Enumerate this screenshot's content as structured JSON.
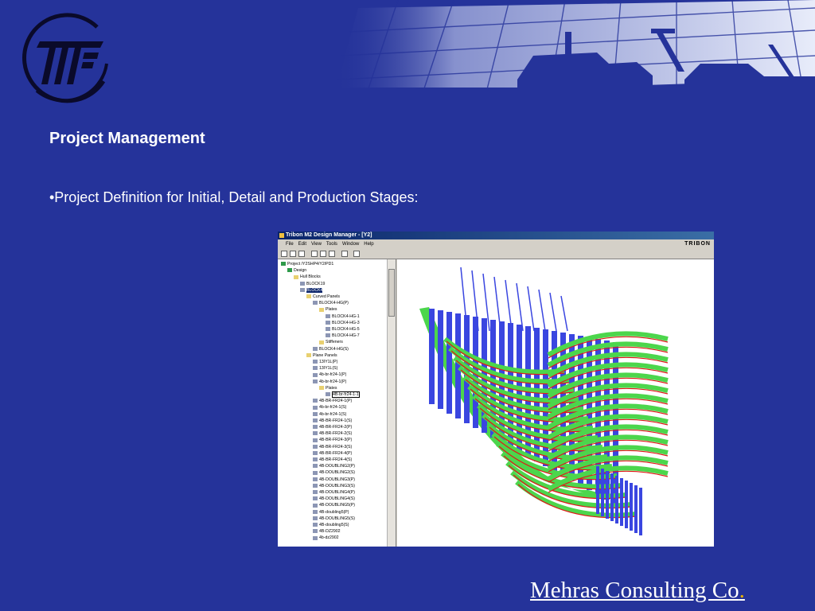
{
  "slide": {
    "heading": "Project Management",
    "bullet": "•Project Definition for Initial, Detail and Production Stages:",
    "footer": "Mehras Consulting Co",
    "footer_period": "."
  },
  "app": {
    "window_title": "Tribon M2 Design Manager - [Y2]",
    "brand": "TRIBON",
    "menu": [
      "File",
      "Edit",
      "View",
      "Tools",
      "Window",
      "Help"
    ],
    "tree": [
      {
        "label": "Project /Y2SHP4/Y2/PD1",
        "icon": "project-icon"
      },
      {
        "label": "Design",
        "icon": "design-icon"
      },
      {
        "label": "Hull Blocks",
        "icon": "folder-icon"
      },
      {
        "label": "BLOCK19",
        "icon": "block-icon"
      },
      {
        "label": "BLOCK4",
        "icon": "block-icon",
        "selected": true
      },
      {
        "label": "Curved Panels",
        "icon": "folder-icon"
      },
      {
        "label": "BLOCK4-HG(P)",
        "icon": "panel-icon"
      },
      {
        "label": "Plates",
        "icon": "folder-icon"
      },
      {
        "label": "BLOCK4-HG-1",
        "icon": "plate-icon"
      },
      {
        "label": "BLOCK4-HG-3",
        "icon": "plate-icon"
      },
      {
        "label": "BLOCK4-HG-5",
        "icon": "plate-icon"
      },
      {
        "label": "BLOCK4-HG-7",
        "icon": "plate-icon"
      },
      {
        "label": "Stiffeners",
        "icon": "folder-icon"
      },
      {
        "label": "BLOCK4-HG(S)",
        "icon": "panel-icon"
      },
      {
        "label": "Plane Panels",
        "icon": "folder-icon"
      },
      {
        "label": "13IY1L(P)",
        "icon": "panel-icon"
      },
      {
        "label": "13IY1L(S)",
        "icon": "panel-icon"
      },
      {
        "label": "4b-br-fr24-1(P)",
        "icon": "panel-icon"
      },
      {
        "label": "4b-br-fr24-1(P)",
        "icon": "panel-icon"
      },
      {
        "label": "Plates",
        "icon": "folder-icon"
      },
      {
        "label": "4B-br-fr24-1-1",
        "icon": "plate-icon",
        "editing": true
      },
      {
        "label": "4B-BR-FR24-1(P)",
        "icon": "panel-icon"
      },
      {
        "label": "4b-br-fr24-1(S)",
        "icon": "panel-icon"
      },
      {
        "label": "4b-br-fr24-1(S)",
        "icon": "panel-icon"
      },
      {
        "label": "4B-BR-FR24-1(S)",
        "icon": "panel-icon"
      },
      {
        "label": "4B-BR-FR24-2(P)",
        "icon": "panel-icon"
      },
      {
        "label": "4B-BR-FR24-2(S)",
        "icon": "panel-icon"
      },
      {
        "label": "4B-BR-FR24-3(P)",
        "icon": "panel-icon"
      },
      {
        "label": "4B-BR-FR24-3(S)",
        "icon": "panel-icon"
      },
      {
        "label": "4B-BR-FR24-4(P)",
        "icon": "panel-icon"
      },
      {
        "label": "4B-BR-FR24-4(S)",
        "icon": "panel-icon"
      },
      {
        "label": "4B-DOUBLING2(P)",
        "icon": "panel-icon"
      },
      {
        "label": "4B-DOUBLING2(S)",
        "icon": "panel-icon"
      },
      {
        "label": "4B-DOUBLING3(P)",
        "icon": "panel-icon"
      },
      {
        "label": "4B-DOUBLING3(S)",
        "icon": "panel-icon"
      },
      {
        "label": "4B-DOUBLING4(P)",
        "icon": "panel-icon"
      },
      {
        "label": "4B-DOUBLING4(S)",
        "icon": "panel-icon"
      },
      {
        "label": "4B-DOUBLING5(P)",
        "icon": "panel-icon"
      },
      {
        "label": "4B-doubling5(P)",
        "icon": "panel-icon"
      },
      {
        "label": "4B-DOUBLING5(S)",
        "icon": "panel-icon"
      },
      {
        "label": "4B-doubling5(S)",
        "icon": "panel-icon"
      },
      {
        "label": "4B-DZ2902",
        "icon": "panel-icon"
      },
      {
        "label": "4b-dz2902",
        "icon": "panel-icon"
      }
    ]
  },
  "colors": {
    "background": "#25339a",
    "hull_green": "#4cd64c",
    "stiffener_blue": "#3a46e0",
    "weld_red": "#e01818"
  }
}
